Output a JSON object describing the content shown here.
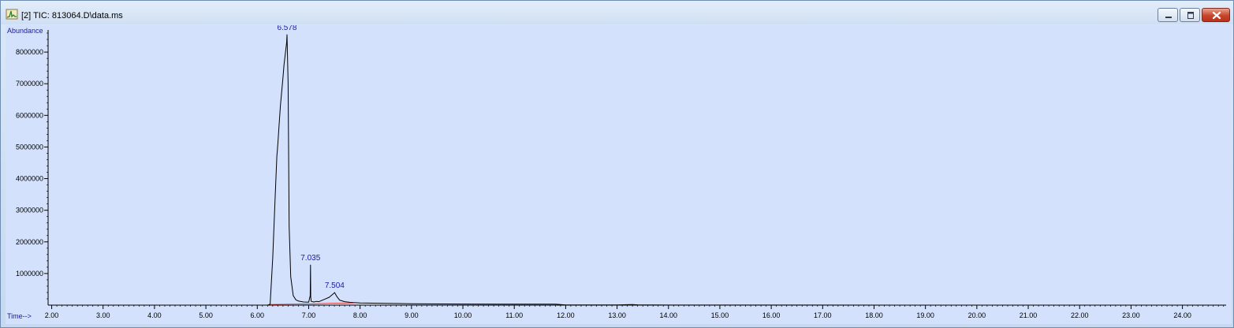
{
  "window": {
    "title": "[2] TIC: 813064.D\\data.ms",
    "controls": [
      "minimize",
      "maximize",
      "close"
    ]
  },
  "chart_data": {
    "type": "line",
    "ylabel": "Abundance",
    "xlabel": "Time-->",
    "xlim": [
      1.93,
      24.85
    ],
    "ylim": [
      0,
      8700000
    ],
    "x_ticks": [
      2.0,
      3.0,
      4.0,
      5.0,
      6.0,
      7.0,
      8.0,
      9.0,
      10.0,
      11.0,
      12.0,
      13.0,
      14.0,
      15.0,
      16.0,
      17.0,
      18.0,
      19.0,
      20.0,
      21.0,
      22.0,
      23.0,
      24.0
    ],
    "x_tick_labels": [
      "2.00",
      "3.00",
      "4.00",
      "5.00",
      "6.00",
      "7.00",
      "8.00",
      "9.00",
      "10.00",
      "11.00",
      "12.00",
      "13.00",
      "14.00",
      "15.00",
      "16.00",
      "17.00",
      "18.00",
      "19.00",
      "20.00",
      "21.00",
      "22.00",
      "23.00",
      "24.00"
    ],
    "y_ticks": [
      1000000,
      2000000,
      3000000,
      4000000,
      5000000,
      6000000,
      7000000,
      8000000
    ],
    "y_tick_labels": [
      "1000000",
      "2000000",
      "3000000",
      "4000000",
      "5000000",
      "6000000",
      "7000000",
      "8000000"
    ],
    "grid": false,
    "series": [
      {
        "color": "#000000",
        "x": [
          1.93,
          6.2,
          6.25,
          6.3,
          6.35,
          6.38,
          6.4,
          6.42,
          6.45,
          6.5,
          6.52,
          6.55,
          6.57,
          6.578,
          6.6,
          6.62,
          6.65,
          6.7,
          6.75,
          6.8,
          6.9,
          7.0,
          7.03,
          7.035,
          7.04,
          7.05,
          7.1,
          7.15,
          7.2,
          7.3,
          7.4,
          7.45,
          7.5,
          7.504,
          7.55,
          7.6,
          7.7,
          7.8,
          8.0,
          8.5,
          9.0,
          10.0,
          11.0,
          11.8,
          12.0,
          13.0,
          13.2,
          13.3,
          13.4,
          14.0,
          16.0,
          20.0,
          24.85
        ],
        "y": [
          0,
          0,
          30000,
          1500000,
          3500000,
          4700000,
          5100000,
          5600000,
          6300000,
          7200000,
          7600000,
          8000000,
          8300000,
          8550000,
          7000000,
          2500000,
          900000,
          300000,
          170000,
          130000,
          100000,
          95000,
          300000,
          1270000,
          250000,
          120000,
          100000,
          120000,
          110000,
          180000,
          250000,
          320000,
          390000,
          400000,
          270000,
          160000,
          110000,
          90000,
          70000,
          55000,
          45000,
          35000,
          30000,
          30000,
          5000,
          5000,
          15000,
          20000,
          10000,
          3000,
          2000,
          1000,
          0
        ]
      },
      {
        "color": "#e0312b",
        "x": [
          6.25,
          7.0,
          7.5,
          7.9
        ],
        "y": [
          20000,
          40000,
          60000,
          70000
        ]
      }
    ],
    "annotations": [
      {
        "text": "6.578",
        "x": 6.578
      },
      {
        "text": "7.035",
        "x": 7.035
      },
      {
        "text": "7.504",
        "x": 7.504
      }
    ]
  }
}
